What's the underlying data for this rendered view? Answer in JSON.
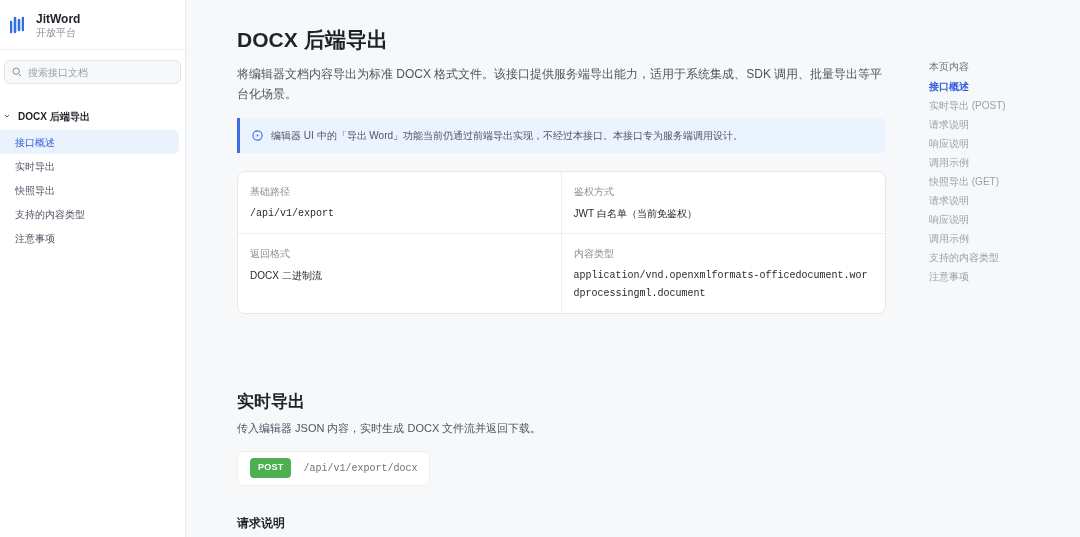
{
  "brand": {
    "name": "JitWord",
    "subtitle": "开放平台"
  },
  "search": {
    "placeholder": "搜索接口文档"
  },
  "nav": {
    "group": {
      "label": "DOCX 后端导出",
      "expanded": true
    },
    "items": [
      {
        "label": "接口概述",
        "selected": true
      },
      {
        "label": "实时导出",
        "selected": false
      },
      {
        "label": "快照导出",
        "selected": false
      },
      {
        "label": "支持的内容类型",
        "selected": false
      },
      {
        "label": "注意事项",
        "selected": false
      }
    ]
  },
  "page": {
    "title": "DOCX 后端导出",
    "intro": "将编辑器文档内容导出为标准 DOCX 格式文件。该接口提供服务端导出能力，适用于系统集成、SDK 调用、批量导出等平台化场景。",
    "note": "编辑器 UI 中的「导出 Word」功能当前仍通过前端导出实现，不经过本接口。本接口专为服务端调用设计。",
    "info": [
      {
        "label": "基础路径",
        "value": "/api/v1/export",
        "kind": "code"
      },
      {
        "label": "鉴权方式",
        "value": "JWT 白名单（当前免鉴权）",
        "kind": "text"
      },
      {
        "label": "返回格式",
        "value": "DOCX 二进制流",
        "kind": "text"
      },
      {
        "label": "内容类型",
        "value": "application/vnd.openxmlformats-officedocument.wordprocessingml.document",
        "kind": "code"
      }
    ]
  },
  "section": {
    "title": "实时导出",
    "description": "传入编辑器 JSON 内容，实时生成 DOCX 文件流并返回下载。",
    "method": "POST",
    "path": "/api/v1/export/docx",
    "subheading": "请求说明"
  },
  "toc": {
    "title": "本页内容",
    "items": [
      {
        "label": "接口概述",
        "selected": true
      },
      {
        "label": "实时导出 (POST)",
        "selected": false
      },
      {
        "label": "请求说明",
        "selected": false
      },
      {
        "label": "响应说明",
        "selected": false
      },
      {
        "label": "调用示例",
        "selected": false
      },
      {
        "label": "快照导出 (GET)",
        "selected": false
      },
      {
        "label": "请求说明",
        "selected": false
      },
      {
        "label": "响应说明",
        "selected": false
      },
      {
        "label": "调用示例",
        "selected": false
      },
      {
        "label": "支持的内容类型",
        "selected": false
      },
      {
        "label": "注意事项",
        "selected": false
      }
    ]
  }
}
